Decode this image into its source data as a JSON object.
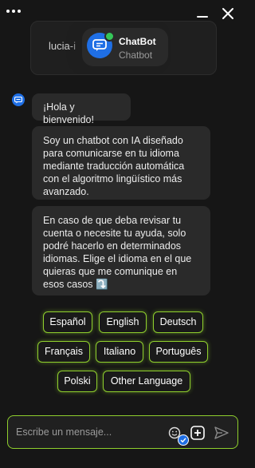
{
  "window": {
    "menu_icon": "more-dots-icon",
    "minimize_icon": "minimize-icon",
    "close_icon": "close-icon"
  },
  "header": {
    "user_name": "lucia-i",
    "bot_name": "ChatBot",
    "bot_role": "Chatbot",
    "status_color": "#35c759",
    "avatar_color": "#1f6fe5"
  },
  "messages": [
    {
      "text": "¡Hola y bienvenido!"
    },
    {
      "text": "Soy un chatbot con IA diseñado para comunicarse en tu idioma mediante traducción automática con el algoritmo lingüístico más avanzado."
    },
    {
      "text": "En caso de que deba revisar tu cuenta o necesite tu ayuda, solo podré hacerlo en determinados idiomas. Elige el idioma en el que quieras que me comunique en esos casos ⤵️"
    }
  ],
  "languages": [
    "Español",
    "English",
    "Deutsch",
    "Français",
    "Italiano",
    "Português",
    "Polski",
    "Other Language"
  ],
  "composer": {
    "placeholder": "Escribe un mensaje...",
    "value": "",
    "accent": "#8fcf2d"
  }
}
